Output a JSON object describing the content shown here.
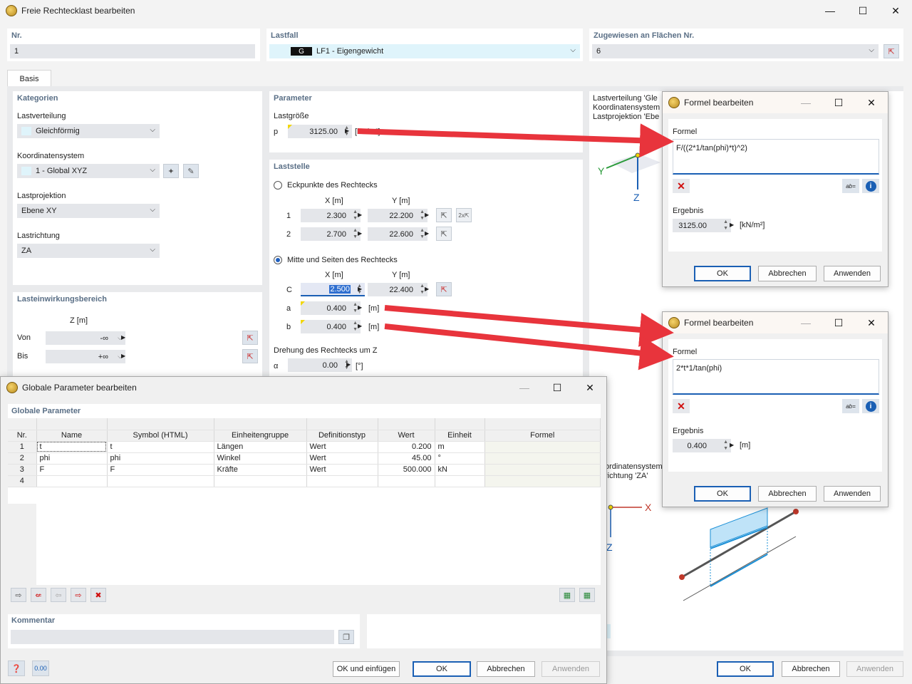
{
  "main_window": {
    "title": "Freie Rechtecklast bearbeiten",
    "min": "—",
    "max": "☐",
    "close": "✕"
  },
  "header": {
    "nr_label": "Nr.",
    "nr_value": "1",
    "lastfall_label": "Lastfall",
    "lastfall_code": "G",
    "lastfall_value": "LF1 - Eigengewicht",
    "zugewiesen_label": "Zugewiesen an Flächen Nr.",
    "zugewiesen_value": "6"
  },
  "tab": "Basis",
  "kategorien": {
    "title": "Kategorien",
    "lastverteilung_label": "Lastverteilung",
    "lastverteilung_value": "Gleichförmig",
    "koordinaten_label": "Koordinatensystem",
    "koordinaten_value": "1 - Global XYZ",
    "lastprojektion_label": "Lastprojektion",
    "lastprojektion_value": "Ebene XY",
    "lastrichtung_label": "Lastrichtung",
    "lastrichtung_value": "ZA"
  },
  "lasteinwirkung": {
    "title": "Lasteinwirkungsbereich",
    "col": "Z [m]",
    "von_label": "Von",
    "von_value": "-∞",
    "bis_label": "Bis",
    "bis_value": "+∞"
  },
  "parameter": {
    "title": "Parameter",
    "lastgroesse_label": "Lastgröße",
    "p_label": "p",
    "p_value": "3125.00",
    "p_unit": "[kN/m²]"
  },
  "laststelle": {
    "title": "Laststelle",
    "opt1": "Eckpunkte des Rechtecks",
    "col_x": "X [m]",
    "col_y": "Y [m]",
    "rows": [
      {
        "n": "1",
        "x": "2.300",
        "y": "22.200"
      },
      {
        "n": "2",
        "x": "2.700",
        "y": "22.600"
      }
    ],
    "opt2": "Mitte und Seiten des Rechtecks",
    "c_label": "C",
    "c_x": "2.500",
    "c_y": "22.400",
    "a_label": "a",
    "a_value": "0.400",
    "a_unit": "[m]",
    "b_label": "b",
    "b_value": "0.400",
    "b_unit": "[m]",
    "drehung_label": "Drehung des Rechtecks um Z",
    "alpha_label": "α",
    "alpha_value": "0.00",
    "alpha_unit": "[°]"
  },
  "right_info": {
    "l1": "Lastverteilung 'Gle",
    "l2": "Koordinatensystem",
    "l3": "Lastprojektion 'Ebe",
    "l4": "ordinatensystem",
    "l5": "richtung 'ZA'"
  },
  "formula1": {
    "title": "Formel bearbeiten",
    "section": "Formel",
    "text": "F/((2*1/tan(phi)*t)^2)",
    "ergebnis_label": "Ergebnis",
    "ergebnis_value": "3125.00",
    "unit": "[kN/m²]",
    "ok": "OK",
    "cancel": "Abbrechen",
    "apply": "Anwenden"
  },
  "formula2": {
    "title": "Formel bearbeiten",
    "section": "Formel",
    "text": "2*t*1/tan(phi)",
    "ergebnis_label": "Ergebnis",
    "ergebnis_value": "0.400",
    "unit": "[m]",
    "ok": "OK",
    "cancel": "Abbrechen",
    "apply": "Anwenden"
  },
  "global_params": {
    "title": "Globale Parameter bearbeiten",
    "section": "Globale Parameter",
    "columns": [
      "Nr.",
      "Name",
      "Symbol (HTML)",
      "Einheitengruppe",
      "Definitionstyp",
      "Wert",
      "Einheit",
      "Formel"
    ],
    "rows": [
      {
        "nr": "1",
        "name": "t",
        "symbol": "t",
        "gruppe": "Längen",
        "typ": "Wert",
        "wert": "0.200",
        "einheit": "m"
      },
      {
        "nr": "2",
        "name": "phi",
        "symbol": "phi",
        "gruppe": "Winkel",
        "typ": "Wert",
        "wert": "45.00",
        "einheit": "°"
      },
      {
        "nr": "3",
        "name": "F",
        "symbol": "F",
        "gruppe": "Kräfte",
        "typ": "Wert",
        "wert": "500.000",
        "einheit": "kN"
      },
      {
        "nr": "4",
        "name": "",
        "symbol": "",
        "gruppe": "",
        "typ": "",
        "wert": "",
        "einheit": ""
      }
    ],
    "kommentar_label": "Kommentar",
    "ok_insert": "OK und einfügen",
    "ok": "OK",
    "cancel": "Abbrechen",
    "apply": "Anwenden"
  },
  "main_buttons": {
    "ok": "OK",
    "cancel": "Abbrechen",
    "apply": "Anwenden"
  },
  "axes": {
    "x": "X",
    "y": "Y",
    "z": "Z"
  },
  "colors": {
    "arrow": "#e8343c",
    "accent": "#1a5fb4",
    "section": "#5a6f86"
  }
}
